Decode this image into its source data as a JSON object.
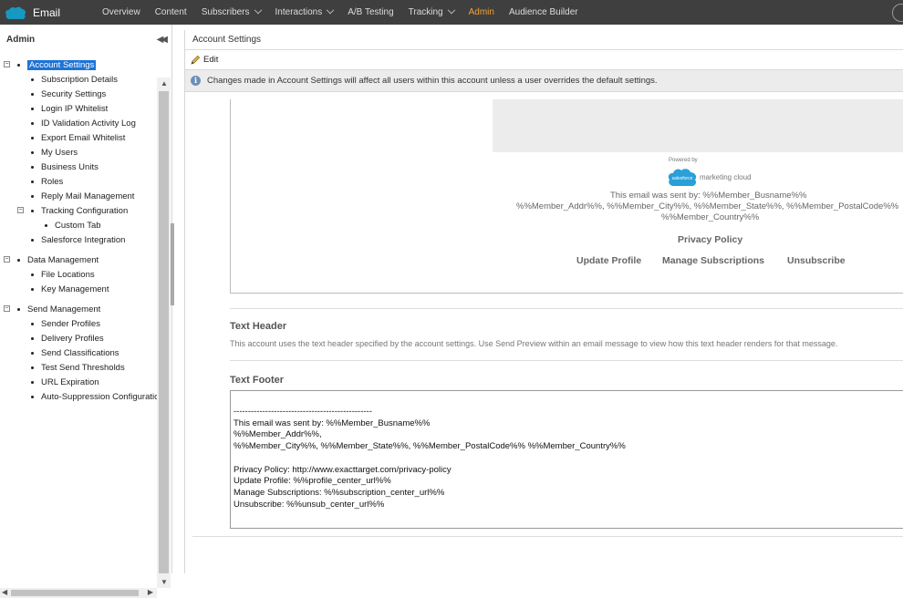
{
  "app": {
    "name": "Email"
  },
  "nav": [
    {
      "label": "Overview",
      "caret": false,
      "active": false
    },
    {
      "label": "Content",
      "caret": false,
      "active": false
    },
    {
      "label": "Subscribers",
      "caret": true,
      "active": false
    },
    {
      "label": "Interactions",
      "caret": true,
      "active": false
    },
    {
      "label": "A/B Testing",
      "caret": false,
      "active": false
    },
    {
      "label": "Tracking",
      "caret": true,
      "active": false
    },
    {
      "label": "Admin",
      "caret": false,
      "active": true
    },
    {
      "label": "Audience Builder",
      "caret": false,
      "active": false
    }
  ],
  "colors": {
    "nav_bg": "#3f3f3f",
    "active": "#f0a23c",
    "selection": "#1e73d6"
  },
  "left": {
    "title": "Admin",
    "tree": [
      {
        "label": "Account Settings",
        "level": 0,
        "toggle": "⊟",
        "selected": true
      },
      {
        "label": "Subscription Details",
        "level": 1
      },
      {
        "label": "Security Settings",
        "level": 1
      },
      {
        "label": "Login IP Whitelist",
        "level": 1
      },
      {
        "label": "ID Validation Activity Log",
        "level": 1
      },
      {
        "label": "Export Email Whitelist",
        "level": 1
      },
      {
        "label": "My Users",
        "level": 1
      },
      {
        "label": "Business Units",
        "level": 1
      },
      {
        "label": "Roles",
        "level": 1
      },
      {
        "label": "Reply Mail Management",
        "level": 1
      },
      {
        "label": "Tracking Configuration",
        "level": 1,
        "toggle": "⊟"
      },
      {
        "label": "Custom Tab",
        "level": 2
      },
      {
        "label": "Salesforce Integration",
        "level": 1
      },
      {
        "label": "Data Management",
        "level": 0,
        "toggle": "⊟",
        "gap": true
      },
      {
        "label": "File Locations",
        "level": 1
      },
      {
        "label": "Key Management",
        "level": 1
      },
      {
        "label": "Send Management",
        "level": 0,
        "toggle": "⊟",
        "gap": true
      },
      {
        "label": "Sender Profiles",
        "level": 1
      },
      {
        "label": "Delivery Profiles",
        "level": 1
      },
      {
        "label": "Send Classifications",
        "level": 1
      },
      {
        "label": "Test Send Thresholds",
        "level": 1
      },
      {
        "label": "URL Expiration",
        "level": 1
      },
      {
        "label": "Auto-Suppression Configuratio",
        "level": 1
      }
    ]
  },
  "main": {
    "title": "Account Settings",
    "edit_label": "Edit",
    "info": "Changes made in Account Settings will affect all users within this account unless a user overrides the default settings.",
    "preview": {
      "powered_by": "Powered by",
      "brand_badge": "salesforce",
      "brand_text": "marketing cloud",
      "sent_line1": "This email was sent by: %%Member_Busname%%",
      "sent_line2": "%%Member_Addr%%, %%Member_City%%, %%Member_State%%, %%Member_PostalCode%%",
      "sent_line3": "%%Member_Country%%",
      "privacy": "Privacy Policy",
      "update_profile": "Update Profile",
      "manage_subs": "Manage Subscriptions",
      "unsubscribe": "Unsubscribe"
    },
    "text_header": {
      "title": "Text Header",
      "desc": "This account uses the text header specified by the account settings. Use Send Preview within an email message to view how this text header renders for that message."
    },
    "text_footer": {
      "title": "Text Footer",
      "lines": [
        "------------------------------------------------",
        "This email was sent by: %%Member_Busname%%",
        "%%Member_Addr%%,",
        "%%Member_City%%, %%Member_State%%, %%Member_PostalCode%% %%Member_Country%%",
        "",
        "Privacy Policy:  http://www.exacttarget.com/privacy-policy",
        "Update Profile: %%profile_center_url%%",
        "Manage Subscriptions:  %%subscription_center_url%%",
        "Unsubscribe:  %%unsub_center_url%%"
      ]
    }
  }
}
